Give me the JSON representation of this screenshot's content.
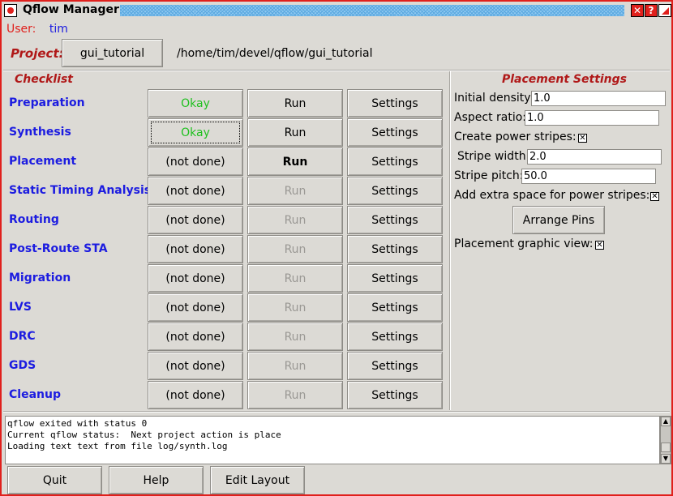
{
  "window": {
    "title": "Qflow Manager"
  },
  "user": {
    "label": "User:",
    "name": "tim"
  },
  "project": {
    "label": "Project:",
    "button_label": "gui_tutorial",
    "path": "/home/tim/devel/qflow/gui_tutorial"
  },
  "checklist": {
    "title": "Checklist",
    "stages": [
      {
        "name": "Preparation",
        "status": "Okay",
        "run": "Run",
        "settings": "Settings"
      },
      {
        "name": "Synthesis",
        "status": "Okay",
        "run": "Run",
        "settings": "Settings"
      },
      {
        "name": "Placement",
        "status": "(not done)",
        "run": "Run",
        "settings": "Settings"
      },
      {
        "name": "Static Timing Analysis",
        "status": "(not done)",
        "run": "Run",
        "settings": "Settings"
      },
      {
        "name": "Routing",
        "status": "(not done)",
        "run": "Run",
        "settings": "Settings"
      },
      {
        "name": "Post-Route STA",
        "status": "(not done)",
        "run": "Run",
        "settings": "Settings"
      },
      {
        "name": "Migration",
        "status": "(not done)",
        "run": "Run",
        "settings": "Settings"
      },
      {
        "name": "LVS",
        "status": "(not done)",
        "run": "Run",
        "settings": "Settings"
      },
      {
        "name": "DRC",
        "status": "(not done)",
        "run": "Run",
        "settings": "Settings"
      },
      {
        "name": "GDS",
        "status": "(not done)",
        "run": "Run",
        "settings": "Settings"
      },
      {
        "name": "Cleanup",
        "status": "(not done)",
        "run": "Run",
        "settings": "Settings"
      }
    ]
  },
  "placement_settings": {
    "title": "Placement Settings",
    "initial_density_label": "Initial density:",
    "initial_density_value": "1.0",
    "aspect_ratio_label": "Aspect ratio:",
    "aspect_ratio_value": "1.0",
    "power_stripes_label": "Create power stripes:",
    "stripe_width_label": "Stripe width:",
    "stripe_width_value": "2.0",
    "stripe_pitch_label": "Stripe pitch:",
    "stripe_pitch_value": "50.0",
    "extra_space_label": "Add extra space for power stripes:",
    "arrange_pins_label": "Arrange Pins",
    "graphic_view_label": "Placement graphic view:"
  },
  "console": {
    "lines": [
      "qflow exited with status 0",
      "Current qflow status:  Next project action is place",
      "Loading text text from file log/synth.log"
    ]
  },
  "footer": {
    "quit": "Quit",
    "help": "Help",
    "edit_layout": "Edit Layout"
  }
}
